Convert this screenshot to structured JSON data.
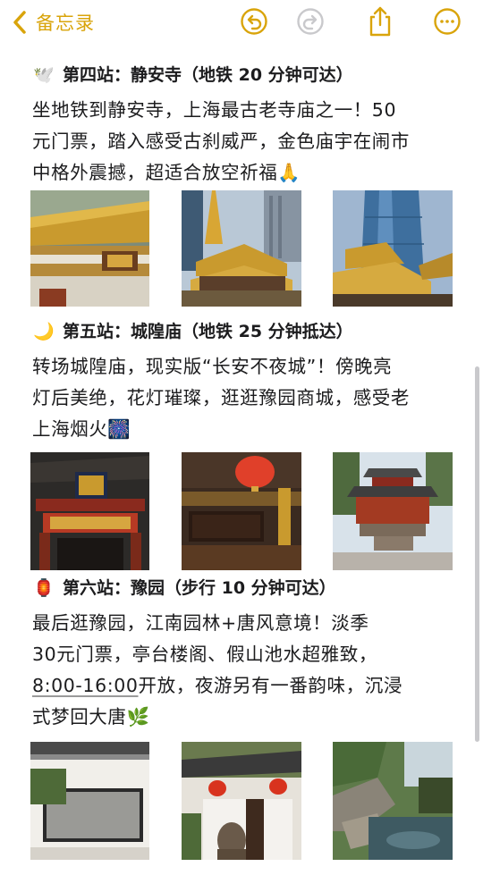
{
  "toolbar": {
    "back_label": "备忘录",
    "accent": "#d9a40b",
    "icons": [
      "chevron-left-icon",
      "undo-icon",
      "redo-icon",
      "share-icon",
      "more-icon"
    ]
  },
  "sections": [
    {
      "emoji": "🕊️",
      "heading": "第四站：静安寺（地铁 20 分钟可达）",
      "lines": [
        "坐地铁到静安寺，上海最古老寺庙之一！50",
        "元门票，踏入感受古刹威严，金色庙宇在闹市",
        "中格外震撼，超适合放空祈福🙏"
      ],
      "images": [
        "jingan-temple-hall",
        "jingan-temple-towers",
        "jingan-temple-skyscraper"
      ]
    },
    {
      "emoji": "🌙",
      "heading": "第五站：城隍庙（地铁 25 分钟抵达）",
      "lines": [
        "转场城隍庙，现实版“长安不夜城”！傍晚亮",
        "灯后美绝，花灯璀璨，逛逛豫园商城，感受老",
        "上海烟火🎆"
      ],
      "images": [
        "chenghuang-temple-gate",
        "chenghuang-lanterns",
        "chenghuang-courtyard"
      ]
    },
    {
      "emoji": "🏮",
      "heading": "第六站：豫园（步行 10 分钟可达）",
      "lines": [
        "最后逛豫园，江南园林+唐风意境！淡季",
        "30元门票，亭台楼阁、假山池水超雅致，",
        "8:00-16:00开放，夜游另有一番韵味，沉浸",
        "式梦回大唐🌿"
      ],
      "line3_underlined": "8:00-16:00",
      "line3_rest": "开放，夜游另有一番韵味，沉浸",
      "images": [
        "yuyuan-wall-plaque",
        "yuyuan-lion-lanterns",
        "yuyuan-pond-rockery"
      ]
    }
  ]
}
